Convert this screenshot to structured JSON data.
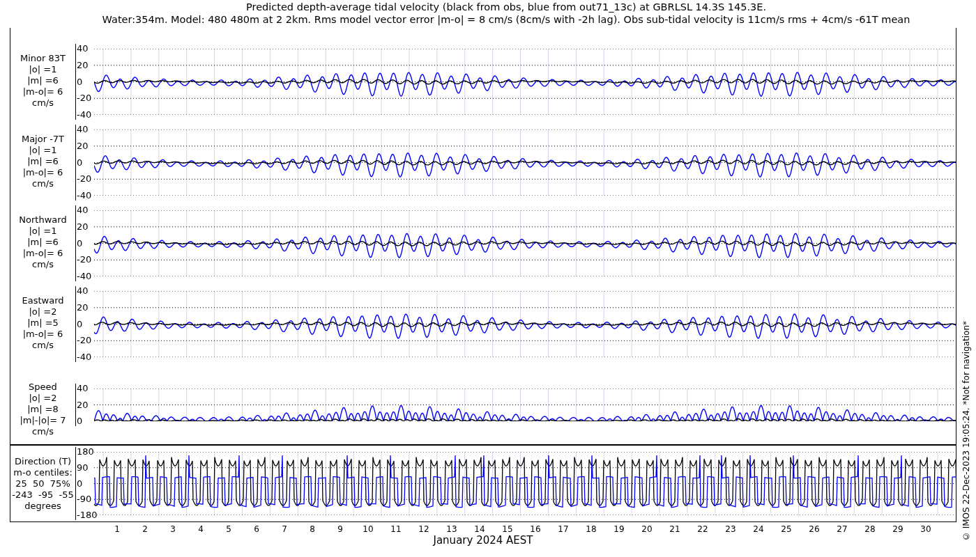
{
  "title": [
    "Predicted depth-average tidal velocity (black from obs, blue from out71_13c) at GBRLSL 14.3S 145.3E.",
    "Water:354m. Model: 480 480m at 2 2km. Rms model vector error |m-o| = 8 cm/s (8cm/s with -2h lag). Obs sub-tidal velocity is 11cm/s rms + 4cm/s -61T mean"
  ],
  "panels": [
    {
      "kind": "signed",
      "label_lines": [
        "Minor 83T",
        "|o| =1",
        "|m| =6",
        "|m-o|= 6",
        "cm/s"
      ],
      "yticks": [
        "40",
        "20",
        "0",
        "-20",
        "-40"
      ]
    },
    {
      "kind": "signed",
      "label_lines": [
        "Major -7T",
        "|o| =1",
        "|m| =6",
        "|m-o|= 6",
        "cm/s"
      ],
      "yticks": [
        "40",
        "20",
        "0",
        "-20",
        "-40"
      ]
    },
    {
      "kind": "signed",
      "label_lines": [
        "Northward",
        "|o| =1",
        "|m| =6",
        "|m-o|= 6",
        "cm/s"
      ],
      "yticks": [
        "40",
        "20",
        "0",
        "-20",
        "-40"
      ]
    },
    {
      "kind": "signed",
      "label_lines": [
        "Eastward",
        "|o| =2",
        "|m| =5",
        "|m-o|= 6",
        "cm/s"
      ],
      "yticks": [
        "40",
        "20",
        "0",
        "-20",
        "-40"
      ]
    },
    {
      "kind": "speed",
      "label_lines": [
        "Speed",
        "|o| =2",
        "|m| =8",
        "|m|-|o|= 7",
        "cm/s"
      ],
      "yticks": [
        "40",
        "20",
        "0"
      ]
    }
  ],
  "direction": {
    "kind": "direction",
    "label_lines": [
      "Direction (T)",
      "m-o centiles:",
      "25  50  75%",
      "-243  -95  -55",
      "degrees"
    ],
    "yticks": [
      "180",
      "90",
      "0",
      "-90",
      "-180"
    ]
  },
  "xaxis": {
    "ticks": [
      "1",
      "2",
      "3",
      "4",
      "5",
      "6",
      "7",
      "8",
      "9",
      "10",
      "11",
      "12",
      "13",
      "14",
      "15",
      "16",
      "17",
      "18",
      "19",
      "20",
      "21",
      "22",
      "23",
      "24",
      "25",
      "26",
      "27",
      "28",
      "29",
      "30"
    ],
    "label": "January 2024 AEST"
  },
  "credit": "© IMOS 22-Dec-2023 19:05:24. *Not for navigation*"
}
